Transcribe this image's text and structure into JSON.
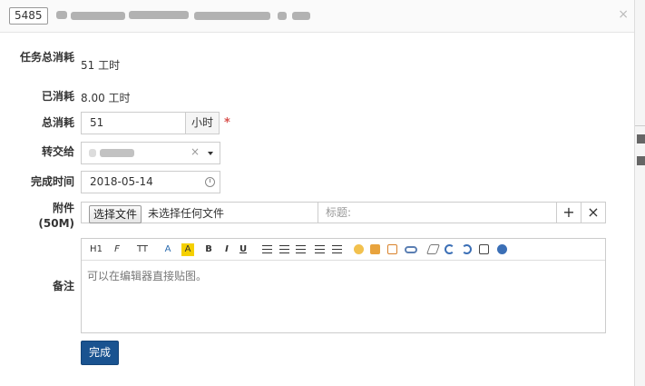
{
  "header": {
    "task_id": "5485",
    "close_glyph": "×"
  },
  "form": {
    "total_consumed": {
      "label": "任务总消耗",
      "value": "51 工时"
    },
    "consumed": {
      "label": "已消耗",
      "value": "8.00 工时"
    },
    "total": {
      "label": "总消耗",
      "value": "51",
      "unit": "小时",
      "required_mark": "*"
    },
    "assign_to": {
      "label": "转交给",
      "clear_glyph": "×"
    },
    "finished_date": {
      "label": "完成时间",
      "value": "2018-05-14"
    },
    "attachment": {
      "label": "附件(50M)",
      "choose_button": "选择文件",
      "no_file_text": "未选择任何文件",
      "title_placeholder": "标题:",
      "add_glyph": "+",
      "remove_glyph": "×"
    },
    "comment": {
      "label": "备注",
      "placeholder": "可以在编辑器直接贴图。",
      "toolbar": {
        "heading": "H1",
        "font_family": "F",
        "font_size": "TT",
        "font_color": "A",
        "bg_color": "A",
        "bold": "B",
        "italic": "I",
        "underline": "U"
      }
    },
    "submit_label": "完成"
  }
}
